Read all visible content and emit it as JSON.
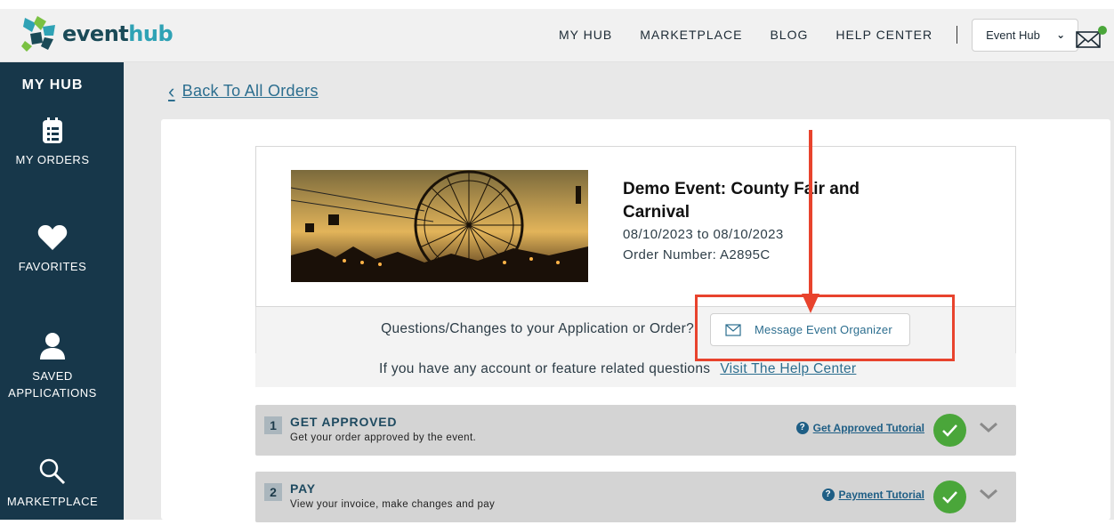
{
  "brand": {
    "name_part1": "event",
    "name_part2": "hub"
  },
  "nav": {
    "items": [
      "MY HUB",
      "MARKETPLACE",
      "BLOG",
      "HELP CENTER"
    ],
    "hub_select": "Event Hub",
    "mail_icon": "envelope-icon"
  },
  "sidebar": {
    "title": "MY HUB",
    "items": [
      {
        "label": "MY ORDERS",
        "icon": "orders-icon"
      },
      {
        "label": "FAVORITES",
        "icon": "heart-icon"
      },
      {
        "label": "SAVED APPLICATIONS",
        "icon": "user-icon"
      },
      {
        "label": "MARKETPLACE",
        "icon": "search-icon"
      }
    ]
  },
  "main": {
    "back_label": "Back To All Orders",
    "event": {
      "title": "Demo Event: County Fair and Carnival",
      "dates": "08/10/2023 to 08/10/2023",
      "order_number": "Order Number: A2895C"
    },
    "questions_text": "Questions/Changes to your Application or Order?",
    "message_button": "Message Event Organizer",
    "help_text": "If you have any account or feature related questions",
    "help_link": "Visit The Help Center",
    "steps": [
      {
        "num": "1",
        "title": "GET APPROVED",
        "subtitle": "Get your order approved by the event.",
        "tutorial": "Get Approved Tutorial",
        "status": "complete"
      },
      {
        "num": "2",
        "title": "PAY",
        "subtitle": "View your invoice, make changes and pay",
        "tutorial": "Payment Tutorial",
        "status": "complete"
      }
    ]
  },
  "colors": {
    "sidebar": "#17374a",
    "accent": "#2c6e8f",
    "annotation": "#e8432d",
    "success": "#4aa63a"
  }
}
